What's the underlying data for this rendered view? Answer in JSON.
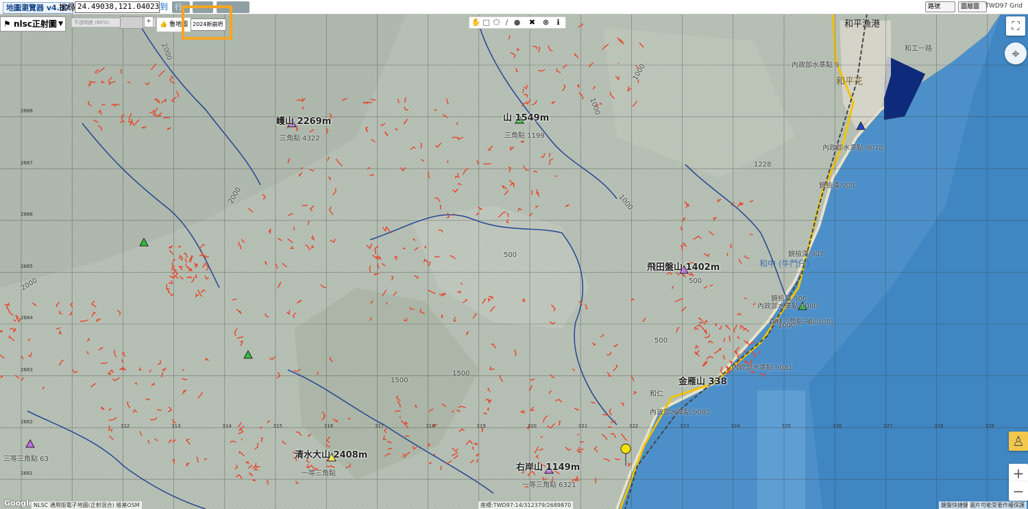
{
  "app": {
    "title": "地圖瀏覽器 v4.37"
  },
  "search": {
    "label": "搜尋",
    "value": "24.49038,121.04023",
    "go": "到",
    "xing": "行"
  },
  "top_right": {
    "select1": "路號",
    "select2": "圖層圖",
    "grid": "TWD97 Grid"
  },
  "layer": {
    "name": "nlsc正射圖",
    "opacity": "不透明度 (80%)",
    "plus": "+",
    "lumap": "魯地圖",
    "year": "2024新崩坍"
  },
  "toolbar": {
    "items": [
      "hand",
      "rect",
      "polygon",
      "line",
      "circle"
    ],
    "close": "✖",
    "clear": "⊗",
    "info": "ℹ"
  },
  "peaks": [
    {
      "name": "㠛山 2269m",
      "sub": "三角點 4322"
    },
    {
      "name": "山 1549m",
      "sub": "三角點 1199"
    },
    {
      "name": "飛田盤山 1402m",
      "sub": ""
    },
    {
      "name": "金雁山 338",
      "sub": ""
    },
    {
      "name": "清水大山 2408m",
      "sub": "一等三角點"
    },
    {
      "name": "右岸山 1149m",
      "sub": "一等三角點 6321"
    }
  ],
  "places": [
    {
      "name": "和平漁港"
    },
    {
      "name": "和工一路"
    },
    {
      "name": "內政部水準點 9"
    },
    {
      "name": "和平花"
    },
    {
      "name": "內政部水準點 9078"
    },
    {
      "name": "1228"
    },
    {
      "name": "鏡檢漢 908"
    },
    {
      "name": "鏡檢漢 907"
    },
    {
      "name": "和中 (牛鬥仔)"
    },
    {
      "name": "鏡檢漢 906"
    },
    {
      "name": "內政部水準點 9080"
    },
    {
      "name": "森林三角點 補山(08)"
    },
    {
      "name": "內政部水準點 9081"
    },
    {
      "name": "內政部水準點 9082"
    },
    {
      "name": "三等三角點 63"
    },
    {
      "name": "和仁"
    }
  ],
  "grid_x": [
    "312",
    "313",
    "314",
    "315",
    "316",
    "317",
    "318",
    "319",
    "320",
    "321",
    "322",
    "323",
    "324",
    "325",
    "326",
    "327",
    "328",
    "329"
  ],
  "grid_y": [
    "2688",
    "2687",
    "2686",
    "2685",
    "2684",
    "2683",
    "2682",
    "2681"
  ],
  "contours": [
    "2000",
    "2000",
    "2000",
    "1500",
    "1500",
    "1000",
    "1000",
    "1000",
    "1000",
    "500",
    "500",
    "500"
  ],
  "footer": {
    "google": "Google",
    "attribution": "NLSC 通用版電子地圖(正射混合) 維基OSM",
    "coords": "座標:TWD97:14/312379/2689870",
    "shortcuts": "鍵盤快捷鍵",
    "terms": "圖片可能受著作權保護"
  },
  "colors": {
    "landslide": "#e8442a",
    "river": "#1d3f8f",
    "sea": "#4d90c9",
    "highlight": "#f5a623",
    "port": "#0e2a7a"
  }
}
